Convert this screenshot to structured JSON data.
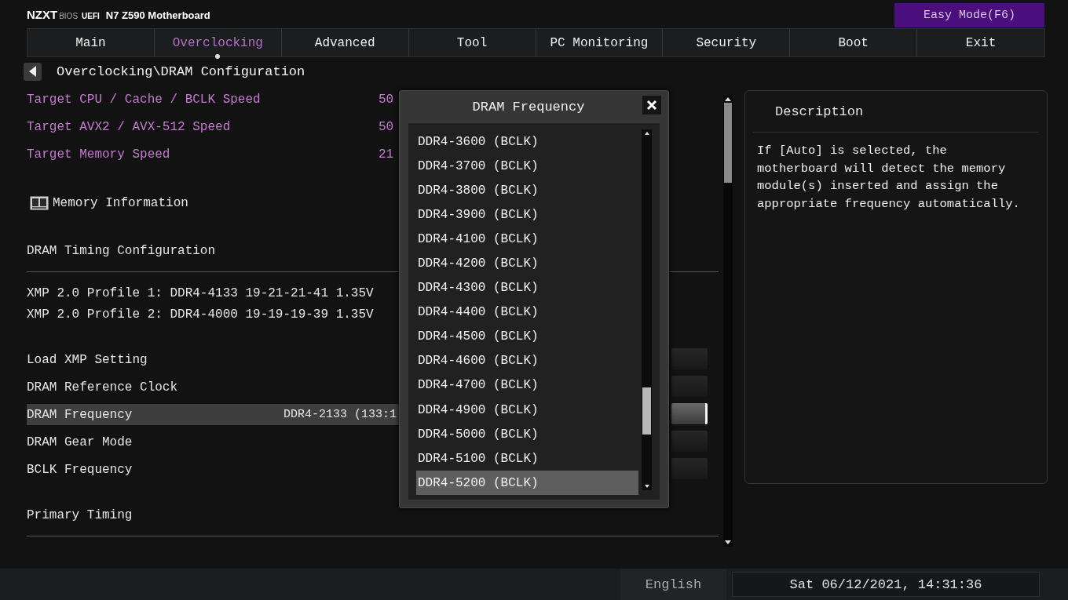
{
  "header": {
    "brand": "NZXT",
    "labels": [
      "BIOS",
      "UEFI"
    ],
    "board": "N7 Z590 Motherboard",
    "mode_button": "Easy Mode(F6)"
  },
  "tabs": [
    {
      "label": "Main",
      "selected": false
    },
    {
      "label": "Overclocking",
      "selected": true
    },
    {
      "label": "Advanced",
      "selected": false
    },
    {
      "label": "Tool",
      "selected": false
    },
    {
      "label": "PC Monitoring",
      "selected": false
    },
    {
      "label": "Security",
      "selected": false
    },
    {
      "label": "Boot",
      "selected": false
    },
    {
      "label": "Exit",
      "selected": false
    }
  ],
  "breadcrumb": "Overclocking\\DRAM Configuration",
  "items": [
    {
      "kind": "target",
      "label": "Target CPU / Cache / BCLK Speed",
      "value": "50"
    },
    {
      "kind": "target",
      "label": "Target AVX2 / AVX-512 Speed",
      "value": "50"
    },
    {
      "kind": "target",
      "label": "Target Memory Speed",
      "value": "21"
    },
    {
      "kind": "info-link",
      "label": "Memory Information"
    },
    {
      "kind": "section",
      "label": "DRAM Timing Configuration"
    },
    {
      "kind": "info",
      "label": "XMP 2.0 Profile 1: DDR4-4133 19-21-21-41 1.35V"
    },
    {
      "kind": "info",
      "label": "XMP 2.0 Profile 2: DDR4-4000 19-19-19-39 1.35V"
    },
    {
      "kind": "setting",
      "label": "Load XMP Setting",
      "selected": false
    },
    {
      "kind": "setting",
      "label": "DRAM Reference Clock",
      "selected": false
    },
    {
      "kind": "setting",
      "label": "DRAM Frequency",
      "value": "DDR4-2133 (133:1",
      "selected": true
    },
    {
      "kind": "setting",
      "label": "DRAM Gear Mode",
      "selected": false
    },
    {
      "kind": "setting",
      "label": "BCLK Frequency",
      "selected": false
    },
    {
      "kind": "section",
      "label": "Primary Timing"
    }
  ],
  "description": {
    "title": "Description",
    "text": "If [Auto] is selected, the motherboard will detect the memory module(s) inserted and assign the appropriate frequency automatically."
  },
  "dialog": {
    "title": "DRAM Frequency",
    "options": [
      {
        "label": "DDR4-3600 (BCLK)",
        "selected": false
      },
      {
        "label": "DDR4-3700 (BCLK)",
        "selected": false
      },
      {
        "label": "DDR4-3800 (BCLK)",
        "selected": false
      },
      {
        "label": "DDR4-3900 (BCLK)",
        "selected": false
      },
      {
        "label": "DDR4-4100 (BCLK)",
        "selected": false
      },
      {
        "label": "DDR4-4200 (BCLK)",
        "selected": false
      },
      {
        "label": "DDR4-4300 (BCLK)",
        "selected": false
      },
      {
        "label": "DDR4-4400 (BCLK)",
        "selected": false
      },
      {
        "label": "DDR4-4500 (BCLK)",
        "selected": false
      },
      {
        "label": "DDR4-4600 (BCLK)",
        "selected": false
      },
      {
        "label": "DDR4-4700 (BCLK)",
        "selected": false
      },
      {
        "label": "DDR4-4900 (BCLK)",
        "selected": false
      },
      {
        "label": "DDR4-5000 (BCLK)",
        "selected": false
      },
      {
        "label": "DDR4-5100 (BCLK)",
        "selected": false
      },
      {
        "label": "DDR4-5200 (BCLK)",
        "selected": true
      }
    ]
  },
  "status_bar": {
    "language": "English",
    "datetime": "Sat 06/12/2021, 14:31:36"
  }
}
